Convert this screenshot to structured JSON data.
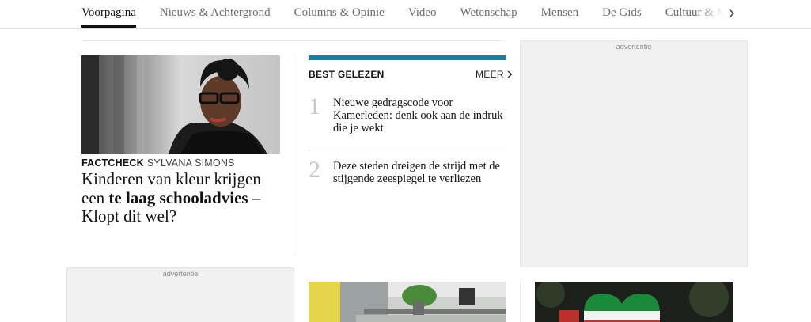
{
  "nav": {
    "tabs": [
      {
        "label": "Voorpagina",
        "active": true
      },
      {
        "label": "Nieuws & Achtergrond"
      },
      {
        "label": "Columns & Opinie"
      },
      {
        "label": "Video"
      },
      {
        "label": "Wetenschap"
      },
      {
        "label": "Mensen"
      },
      {
        "label": "De Gids"
      },
      {
        "label": "Cultuur & Media"
      }
    ],
    "next_icon": "chevron-right-icon"
  },
  "feature": {
    "kicker": "FACTCHECK",
    "author": "SYLVANA SIMONS",
    "headline_part1": "Kinderen van kleur krijgen een ",
    "headline_bold": "te laag schooladvies",
    "headline_part2": " – Klopt dit wel?"
  },
  "best_gelezen": {
    "title": "BEST GELEZEN",
    "more_label": "MEER",
    "accent_color": "#1a7ba3",
    "items": [
      {
        "number": "1",
        "text": "Nieuwe gedragscode voor Kamerleden: denk ook aan de indruk die je wekt"
      },
      {
        "number": "2",
        "text": "Deze steden dreigen de strijd met de stijgende zeespiegel te verliezen"
      }
    ]
  },
  "ads": {
    "right_label": "advertentie",
    "bottom_left_label": "advertentie"
  }
}
